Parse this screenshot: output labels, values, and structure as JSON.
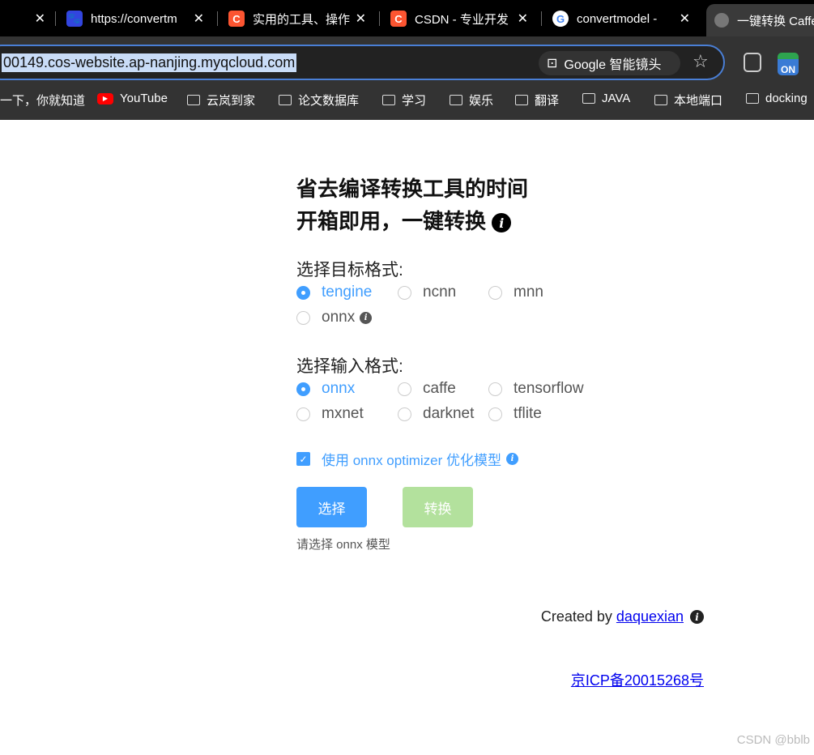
{
  "browser": {
    "tabs": [
      {
        "title": "https://convertm",
        "icon": "baidu-icon"
      },
      {
        "title": "实用的工具、操作",
        "icon": "csdn-icon"
      },
      {
        "title": "CSDN - 专业开发",
        "icon": "csdn-icon"
      },
      {
        "title": "convertmodel -",
        "icon": "google-icon"
      }
    ],
    "active_tab": "一键转换 Caffe",
    "url": "00149.cos-website.ap-nanjing.myqcloud.com",
    "lens_label": "Google 智能镜头",
    "extension_badge": "ON",
    "bookmarks": [
      "一下，你就知道",
      "YouTube",
      "云岚到家",
      "论文数据库",
      "学习",
      "娱乐",
      "翻译",
      "JAVA",
      "本地端口",
      "docking"
    ]
  },
  "page": {
    "title_line1": "省去编译转换工具的时间",
    "title_line2": "开箱即用，一键转换",
    "target_label": "选择目标格式:",
    "target_options": [
      "tengine",
      "ncnn",
      "mnn",
      "onnx"
    ],
    "target_selected": "tengine",
    "input_label": "选择输入格式:",
    "input_options": [
      "onnx",
      "caffe",
      "tensorflow",
      "mxnet",
      "darknet",
      "tflite"
    ],
    "input_selected": "onnx",
    "optimizer_label": "使用 onnx optimizer 优化模型",
    "optimizer_checked": true,
    "select_button": "选择",
    "convert_button": "转换",
    "hint": "请选择 onnx 模型",
    "created_by": "Created by",
    "author": "daquexian",
    "icp": "京ICP备20015268号",
    "watermark": "CSDN @bblb",
    "colors": {
      "accent": "#409eff",
      "convert_disabled": "#b3e19d"
    }
  }
}
